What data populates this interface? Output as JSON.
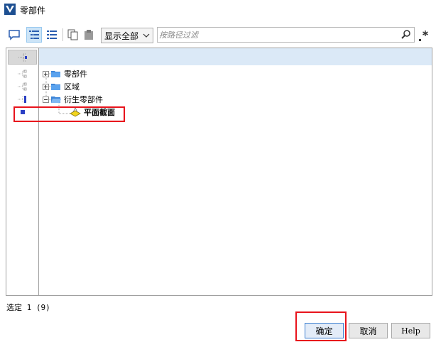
{
  "window": {
    "title": "零部件"
  },
  "toolbar": {
    "show_select_value": "显示全部",
    "search_placeholder": "按路径过滤",
    "buttons": [
      "comment-icon",
      "tree-view-icon",
      "list-view-icon",
      "copy-icon",
      "paste-icon"
    ]
  },
  "tree": {
    "items": [
      {
        "label": "零部件",
        "expanded": false
      },
      {
        "label": "区域",
        "expanded": false
      },
      {
        "label": "衍生零部件",
        "expanded": true
      },
      {
        "label": "平面截面",
        "selected": true
      }
    ]
  },
  "status": {
    "selection_text": "选定 1 (9)"
  },
  "buttons": {
    "ok": "确定",
    "cancel": "取消",
    "help": "Help"
  },
  "colors": {
    "accent": "#2a5db0",
    "highlight": "#e8131c",
    "header": "#dbe9f7"
  }
}
